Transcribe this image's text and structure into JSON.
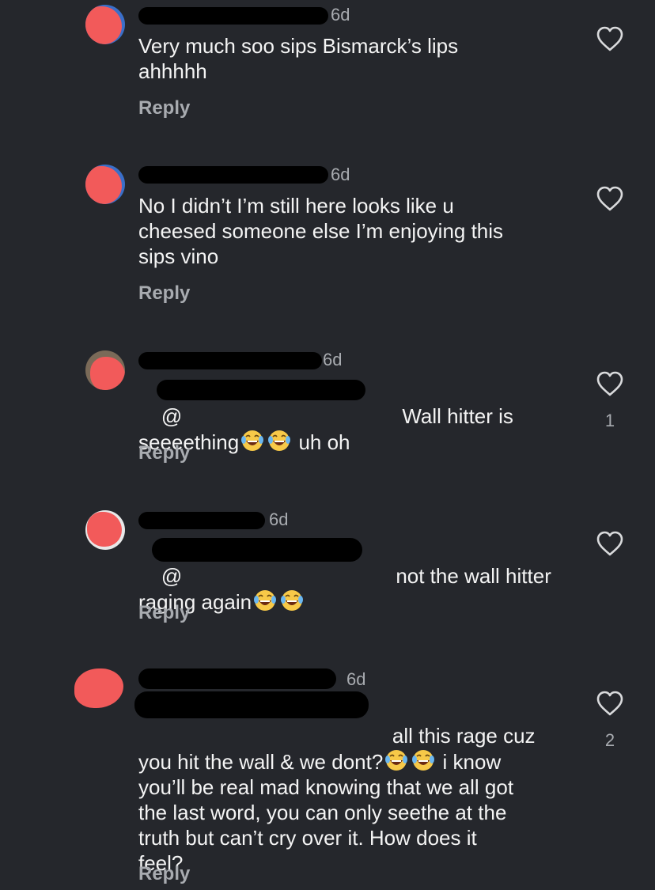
{
  "comments": [
    {
      "time": "6d",
      "text": "Very much soo sips Bismarck’s lips\nahhhhh",
      "reply_label": "Reply",
      "like_count": ""
    },
    {
      "time": "6d",
      "text": "No I didn’t I’m still here looks like u\ncheesed someone else I’m enjoying this\nsips vino",
      "reply_label": "Reply",
      "like_count": ""
    },
    {
      "time": "6d",
      "mention_prefix": "@",
      "text_line1": "Wall hitter is",
      "text_line2a": "seeeething",
      "text_line2b": " uh oh",
      "reply_label": "Reply",
      "like_count": "1"
    },
    {
      "time": "6d",
      "mention_prefix": "@",
      "text_line1": "not the wall hitter",
      "text_line2a": "raging again",
      "reply_label": "Reply",
      "like_count": ""
    },
    {
      "time": "6d",
      "text_line1": "all this rage cuz",
      "text_line2a": "you hit the wall & we dont?",
      "text_line2b": " i know",
      "text_rest": "you’ll be real mad knowing that we all got\nthe last word, you can only seethe at the\ntruth but can’t cry over it. How does it\nfeel?",
      "reply_label": "Reply",
      "like_count": "2"
    }
  ],
  "icons": {
    "heart": "heart-outline-icon",
    "emoji": "face-with-tears-of-joy-icon"
  },
  "colors": {
    "background": "#25272c",
    "text": "#f4f4f4",
    "muted": "#a8abb0"
  }
}
